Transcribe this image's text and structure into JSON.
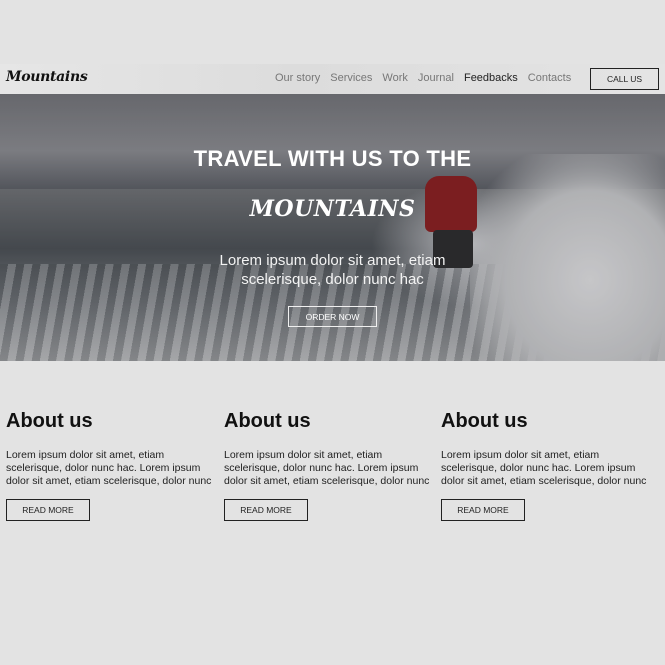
{
  "brand": "Mountains",
  "nav": {
    "links": [
      "Our story",
      "Services",
      "Work",
      "Journal",
      "Feedbacks",
      "Contacts"
    ],
    "active_index": 4,
    "call_label": "CALL US"
  },
  "hero": {
    "title": "TRAVEL WITH US TO THE",
    "subtitle": "MOUNTAINS",
    "text": "Lorem ipsum dolor sit amet, etiam scelerisque, dolor nunc hac",
    "button_label": "ORDER NOW"
  },
  "columns": [
    {
      "heading": "About us",
      "text": "Lorem ipsum dolor sit amet, etiam scelerisque, dolor nunc hac. Lorem ipsum dolor sit amet, etiam scelerisque, dolor nunc",
      "button_label": "READ MORE"
    },
    {
      "heading": "About us",
      "text": "Lorem ipsum dolor sit amet, etiam scelerisque, dolor nunc hac. Lorem ipsum dolor sit amet, etiam scelerisque, dolor nunc",
      "button_label": "READ MORE"
    },
    {
      "heading": "About us",
      "text": "Lorem ipsum dolor sit amet, etiam scelerisque, dolor nunc hac. Lorem ipsum dolor sit amet, etiam scelerisque, dolor nunc",
      "button_label": "READ MORE"
    }
  ],
  "colors": {
    "page_background": "#e3e3e3",
    "text": "#111111",
    "nav_muted": "#777777"
  }
}
